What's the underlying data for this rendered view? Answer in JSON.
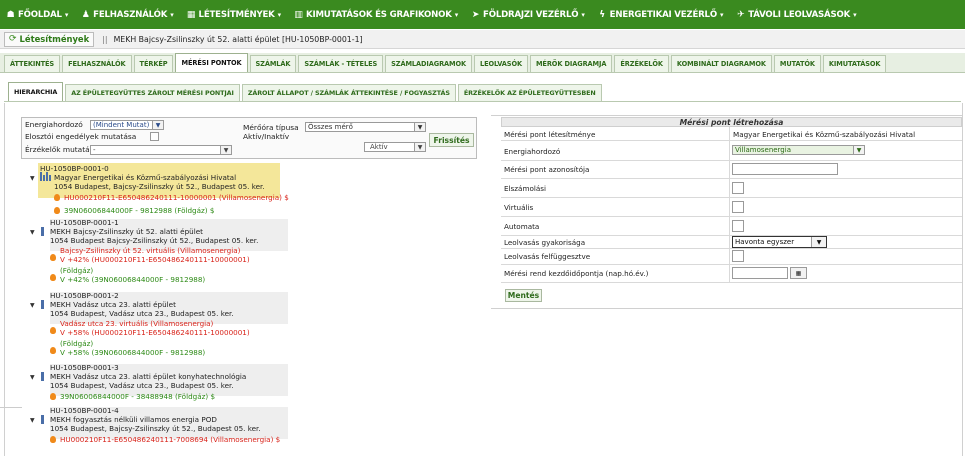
{
  "topnav": {
    "items": [
      {
        "icon": "home-icon",
        "glyph": "☗",
        "label": "FŐOLDAL"
      },
      {
        "icon": "users-icon",
        "glyph": "♟",
        "label": "FELHASZNÁLÓK"
      },
      {
        "icon": "building-icon",
        "glyph": "▦",
        "label": "LÉTESÍTMÉNYEK"
      },
      {
        "icon": "chart-icon",
        "glyph": "▥",
        "label": "KIMUTATÁSOK ÉS GRAFIKONOK"
      },
      {
        "icon": "navigation-icon",
        "glyph": "➤",
        "label": "FÖLDRAJZI VEZÉRLŐ"
      },
      {
        "icon": "lightning-icon",
        "glyph": "ϟ",
        "label": "ENERGETIKAI VEZÉRLŐ"
      },
      {
        "icon": "signal-icon",
        "glyph": "✈",
        "label": "TÁVOLI LEOLVASÁSOK"
      }
    ]
  },
  "breadcrumb": {
    "home_label": "Létesítmények",
    "separator": "||",
    "path": "MEKH Bajcsy-Zsilinszky út 52. alatti épület [HU-1050BP-0001-1]"
  },
  "tabs_main": [
    "ÁTTEKINTÉS",
    "FELHASZNÁLÓK",
    "TÉRKÉP",
    "MÉRÉSI PONTOK",
    "SZÁMLÁK",
    "SZÁMLÁK - TÉTELES",
    "SZÁMLADIAGRAMOK",
    "LEOLVASÓK",
    "MÉRŐK DIAGRAMJA",
    "ÉRZÉKELŐK",
    "KOMBINÁLT DIAGRAMOK",
    "MUTATÓK",
    "KIMUTATÁSOK"
  ],
  "tabs_main_active": "MÉRÉSI PONTOK",
  "tabs_sub": [
    "HIERARCHIA",
    "AZ ÉPÜLETEGYÜTTES ZÁROLT MÉRÉSI PONTJAI",
    "ZÁROLT ÁLLAPOT / SZÁMLÁK ÁTTEKINTÉSE / FOGYASZTÁS",
    "ÉRZÉKELŐK AZ ÉPÜLETEGYÜTTESBEN"
  ],
  "tabs_sub_active": "HIERARCHIA",
  "filter": {
    "energy_label": "Energiahordozó",
    "energy_value": "(Mindent Mutat)",
    "permissions_label": "Elosztói engedélyek mutatása",
    "sensors_label": "Érzékelők mutatása",
    "sensors_value": "-",
    "meter_type_label": "Mérőóra típusa",
    "meter_type_value": "Összes mérő",
    "active_label": "Aktív/Inaktív",
    "active_value": "Aktív",
    "refresh_label": "Frissítés"
  },
  "tree": {
    "lines": [
      "HU-1050BP-0001-0",
      "Magyar Energetikai és Közmű-szabályozási Hivatal",
      "1054 Budapest, Bajcsy-Zsilinszky út 52., Budapest 05. ker.",
      "HU000210F11-E650486240111-10000001 (Villamosenergia) $",
      "39N06006844000F - 9812988 (Földgáz) $",
      "HU-1050BP-0001-1",
      "MEKH Bajcsy-Zsilinszky út 52. alatti épület",
      "1054 Budapest Bajcsy-Zsilinszky út 52., Budapest 05. ker.",
      "Bajcsy-Zsilinszky út 52. virtuális (Villamosenergia)",
      "V +42% (HU000210F11-E650486240111-10000001)",
      "(Földgáz)",
      "V +42% (39N06006844000F - 9812988)",
      "HU-1050BP-0001-2",
      "MEKH Vadász utca 23. alatti épület",
      "1054 Budapest, Vadász utca 23., Budapest 05. ker.",
      "Vadász utca 23. virtuális (Villamosenergia)",
      "V +58% (HU000210F11-E650486240111-10000001)",
      "(Földgáz)",
      "V +58% (39N06006844000F - 9812988)",
      "HU-1050BP-0001-3",
      "MEKH Vadász utca 23. alatti épület konyhatechnológia",
      "1054 Budapest, Vadász utca 23., Budapest 05. ker.",
      "39N06006844000F - 38488948 (Földgáz) $",
      "HU-1050BP-0001-4",
      "MEKH fogyasztás nélküli villamos energia POD",
      "1054 Budapest, Bajcsy-Zsilinszky út 52., Budapest 05. ker.",
      "HU000210F11-E650486240111-7008694 (Villamosenergia) $"
    ]
  },
  "form": {
    "title": "Mérési pont létrehozása",
    "facility_label": "Mérési pont létesítménye",
    "facility_value": "Magyar Energetikai és Közmű-szabályozási Hivatal",
    "energy_label": "Energiahordozó",
    "energy_value": "Villamosenergia",
    "id_label": "Mérési pont azonosítója",
    "billing_label": "Elszámolási",
    "virtual_label": "Virtuális",
    "automatic_label": "Automata",
    "frequency_label": "Leolvasás gyakorisága",
    "frequency_value": "Havonta egyszer",
    "suspended_label": "Leolvasás felfüggesztve",
    "start_label": "Mérési rend kezdőidőpontja (nap.hó.év.)",
    "save_label": "Mentés"
  }
}
